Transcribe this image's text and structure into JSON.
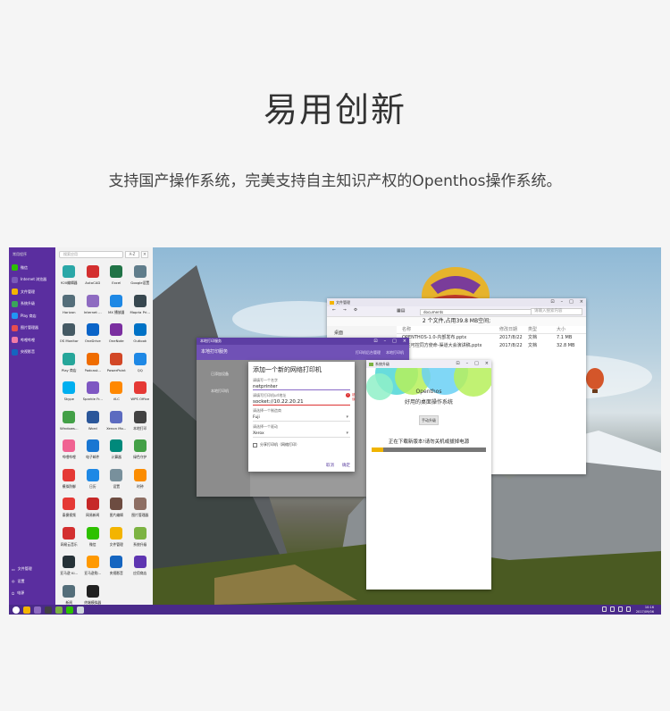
{
  "page": {
    "heading": "易用创新",
    "subtitle": "支持国产操作系统，完美支持自主知识产权的Openthos操作系统。"
  },
  "launcher": {
    "header": "常用程序",
    "items": [
      {
        "label": "微信",
        "color": "#2dc100"
      },
      {
        "label": "Internet 浏览器",
        "color": "#7a5ab8"
      },
      {
        "label": "文件管理",
        "color": "#f3b400"
      },
      {
        "label": "系统升级",
        "color": "#3aa55a"
      },
      {
        "label": "Play 商店",
        "color": "#2196f3"
      },
      {
        "label": "图片管理器",
        "color": "#e94e4e"
      },
      {
        "label": "哔哩哔哩",
        "color": "#f27aa6"
      },
      {
        "label": "央视影音",
        "color": "#1565c0"
      }
    ],
    "bottom": [
      {
        "label": "文件管理"
      },
      {
        "label": "设置"
      },
      {
        "label": "电源"
      }
    ]
  },
  "apps": {
    "search_placeholder": "搜索应用",
    "sort": "A-Z",
    "items": [
      {
        "label": "920编辑器",
        "color": "#2aa7a7"
      },
      {
        "label": "AutoCAD",
        "color": "#d32f2f"
      },
      {
        "label": "Excel",
        "color": "#217346"
      },
      {
        "label": "Google设置",
        "color": "#607d8b"
      },
      {
        "label": "Horizon",
        "color": "#546e7a"
      },
      {
        "label": "Internet ...",
        "color": "#8e6bc1"
      },
      {
        "label": "MX 播放器",
        "color": "#1e88e5"
      },
      {
        "label": "Mopria Pri...",
        "color": "#37474f"
      },
      {
        "label": "OS Monitor",
        "color": "#455a64"
      },
      {
        "label": "OneDrive",
        "color": "#0a64c8"
      },
      {
        "label": "OneNote",
        "color": "#7b2fa0"
      },
      {
        "label": "Outlook",
        "color": "#0072c6"
      },
      {
        "label": "Play 商店",
        "color": "#26a69a"
      },
      {
        "label": "Podcast...",
        "color": "#ef6c00"
      },
      {
        "label": "PowerPoint",
        "color": "#d24726"
      },
      {
        "label": "QQ",
        "color": "#1e88e5"
      },
      {
        "label": "Skype",
        "color": "#00aff0"
      },
      {
        "label": "Sparkle Fr...",
        "color": "#7e57c2"
      },
      {
        "label": "VLC",
        "color": "#ff8800"
      },
      {
        "label": "WPS Office",
        "color": "#e53935"
      },
      {
        "label": "Windows...",
        "color": "#43a047"
      },
      {
        "label": "Word",
        "color": "#2b579a"
      },
      {
        "label": "Xenon Mo...",
        "color": "#5c6bc0"
      },
      {
        "label": "本地打印",
        "color": "#424242"
      },
      {
        "label": "哔哩哔哩",
        "color": "#f06292"
      },
      {
        "label": "电子邮件",
        "color": "#1976d2"
      },
      {
        "label": "计算器",
        "color": "#00897b"
      },
      {
        "label": "绿色守护",
        "color": "#43a047"
      },
      {
        "label": "模拟防御",
        "color": "#e53935"
      },
      {
        "label": "日历",
        "color": "#1e88e5"
      },
      {
        "label": "设置",
        "color": "#78909c"
      },
      {
        "label": "时钟",
        "color": "#fb8c00"
      },
      {
        "label": "泰捷视频",
        "color": "#e53935"
      },
      {
        "label": "网易新闻",
        "color": "#c62828"
      },
      {
        "label": "图片编辑",
        "color": "#6d4c41"
      },
      {
        "label": "图片管理器",
        "color": "#8d6e63"
      },
      {
        "label": "网易云音乐",
        "color": "#d32f2f"
      },
      {
        "label": "微信",
        "color": "#2dc100"
      },
      {
        "label": "文件管理",
        "color": "#f3b400"
      },
      {
        "label": "系统升级",
        "color": "#7cb342"
      },
      {
        "label": "亚马逊 Ki...",
        "color": "#263238"
      },
      {
        "label": "亚马逊购...",
        "color": "#ff9900"
      },
      {
        "label": "央视影音",
        "color": "#1565c0"
      },
      {
        "label": "应用商店",
        "color": "#5e35b1"
      },
      {
        "label": "新闻",
        "color": "#546e7a"
      },
      {
        "label": "终端模拟器",
        "color": "#212121"
      }
    ]
  },
  "taskbar": {
    "time": "10:16",
    "date": "2017/09/06"
  },
  "file_manager": {
    "title": "文件管理",
    "path": "documents",
    "search_placeholder": "请输入搜索内容",
    "status": "2 个文件,占用39.8 MB空间;",
    "sidebar": [
      "桌面"
    ],
    "columns": [
      "名称",
      "修改日期",
      "类型",
      "大小"
    ],
    "rows": [
      {
        "name": "OPENTHOS-1.0-内部发布.pptx",
        "date": "2017/8/22",
        "type": "文档",
        "size": "7.1 MB"
      },
      {
        "name": "...主可控同方使命-渠道大会演讲稿.pptx",
        "date": "2017/8/22",
        "type": "文档",
        "size": "32.8 MB"
      }
    ]
  },
  "print_service": {
    "title": "本地打印服务",
    "app_title": "本地打印服务",
    "action1": "打印机后台管理",
    "action2": "本地打印机",
    "side_items": [
      "已添加设备",
      "本地打印机"
    ]
  },
  "dialog": {
    "title": "添加一个新的网络打印机",
    "name_label": "请填写一个名字",
    "name_value": "netprinter",
    "url_label": "请填写打印机url地址",
    "url_value": "socket://10.22.20.21",
    "error_badge": "!",
    "error_text": "错误",
    "maker_label": "请选择一个制造商",
    "maker_value": "Fuji",
    "driver_label": "请选择一个驱动",
    "driver_value": "Xerox",
    "share_label": "分享打印机（网络打印）",
    "cancel": "取消",
    "ok": "确定"
  },
  "upgrade": {
    "title": "系统升级",
    "h1": "Openthos",
    "h2": "好用的桌面操作系统",
    "button": "手动升级",
    "message": "正在下载新版本!请勿关机或拔掉电源",
    "progress": 0.1
  }
}
